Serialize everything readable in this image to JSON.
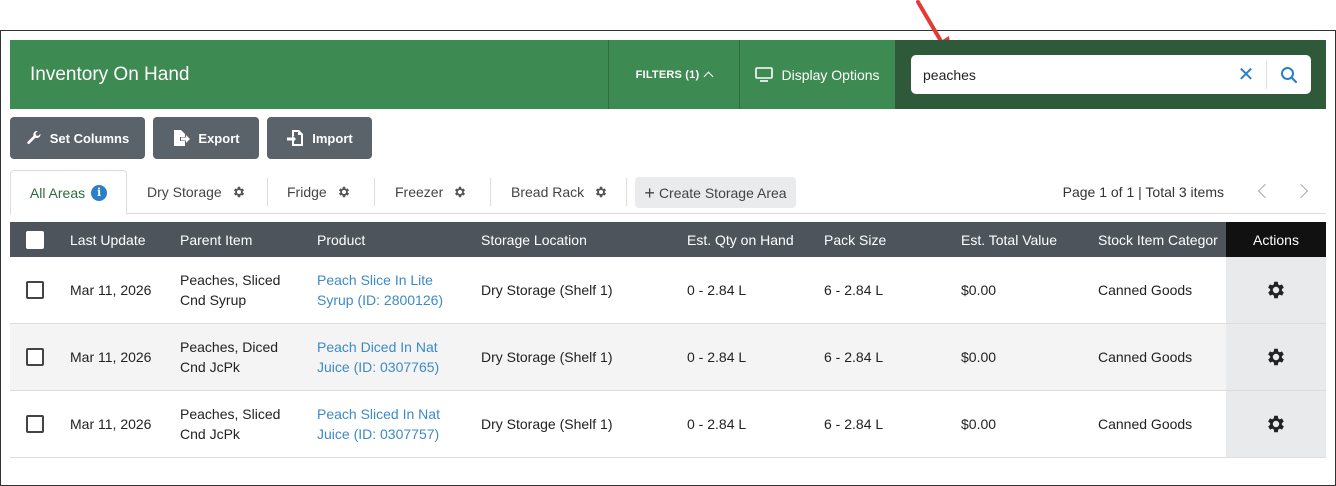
{
  "header": {
    "title": "Inventory On Hand",
    "filters_label": "FILTERS (1)",
    "display_options_label": "Display Options",
    "search_value": "peaches",
    "clear_symbol": "✕"
  },
  "toolbar": {
    "set_columns": "Set Columns",
    "export": "Export",
    "import": "Import"
  },
  "tabs": {
    "items": [
      {
        "label": "All Areas",
        "active": true,
        "icon": "info-icon"
      },
      {
        "label": "Dry Storage",
        "icon": "gear-icon"
      },
      {
        "label": "Fridge",
        "icon": "gear-icon"
      },
      {
        "label": "Freezer",
        "icon": "gear-icon"
      },
      {
        "label": "Bread Rack",
        "icon": "gear-icon"
      }
    ],
    "info_glyph": "i",
    "create_label": "Create Storage Area",
    "create_plus": "+",
    "pager_text": "Page 1 of 1 | Total 3 items"
  },
  "table": {
    "headers": [
      "Last Update",
      "Parent Item",
      "Product",
      "Storage Location",
      "Est. Qty on Hand",
      "Pack Size",
      "Est. Total Value",
      "Stock Item Categor",
      "Actions"
    ],
    "rows": [
      {
        "last_update": "Mar 11, 2026",
        "parent_1": "Peaches, Sliced",
        "parent_2": "Cnd Syrup",
        "product_1": "Peach Slice In Lite",
        "product_2": "Syrup (ID: 2800126)",
        "location": "Dry Storage (Shelf 1)",
        "qty": "0 - 2.84 L",
        "pack": "6 - 2.84 L",
        "value": "$0.00",
        "category": "Canned Goods"
      },
      {
        "last_update": "Mar 11, 2026",
        "parent_1": "Peaches, Diced",
        "parent_2": "Cnd JcPk",
        "product_1": "Peach Diced In Nat",
        "product_2": "Juice (ID: 0307765)",
        "location": "Dry Storage (Shelf 1)",
        "qty": "0 - 2.84 L",
        "pack": "6 - 2.84 L",
        "value": "$0.00",
        "category": "Canned Goods"
      },
      {
        "last_update": "Mar 11, 2026",
        "parent_1": "Peaches, Sliced",
        "parent_2": "Cnd JcPk",
        "product_1": "Peach Sliced In Nat",
        "product_2": "Juice (ID: 0307757)",
        "location": "Dry Storage (Shelf 1)",
        "qty": "0 - 2.84 L",
        "pack": "6 - 2.84 L",
        "value": "$0.00",
        "category": "Canned Goods"
      }
    ]
  },
  "colors": {
    "header_green": "#3d8a52",
    "search_bg": "#2f5a3a",
    "link_blue": "#3c8ac8",
    "table_header": "#4d545b",
    "annotation_red": "#e53935"
  }
}
